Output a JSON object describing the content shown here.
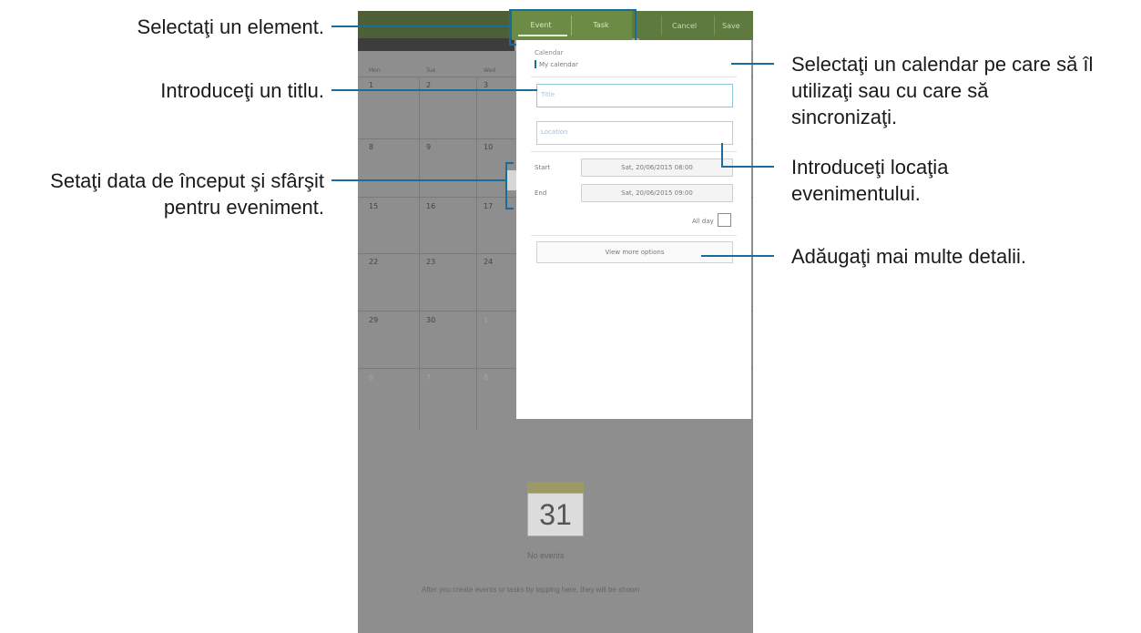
{
  "annotations": {
    "select_item": "Selectaţi un element.",
    "enter_title": "Introduceţi un titlu.",
    "set_dates_1": "Setaţi data de început şi sfârşit",
    "set_dates_2": "pentru eveniment.",
    "select_calendar_1": "Selectaţi un calendar pe care să îl",
    "select_calendar_2": "utilizaţi sau cu care să",
    "select_calendar_3": "sincronizaţi.",
    "enter_location_1": "Introduceţi locaţia",
    "enter_location_2": "evenimentului.",
    "add_details": "Adăugaţi mai multe detalii."
  },
  "tabs": {
    "event": "Event",
    "task": "Task"
  },
  "toolbar": {
    "cancel": "Cancel",
    "save": "Save"
  },
  "form": {
    "calendar_label": "Calendar",
    "calendar_value": "My calendar",
    "title_placeholder": "Title",
    "location_placeholder": "Location",
    "start_label": "Start",
    "start_value": "Sat, 20/06/2015 08:00",
    "end_label": "End",
    "end_value": "Sat, 20/06/2015 09:00",
    "allday_label": "All day",
    "more_options": "View more options"
  },
  "calendar": {
    "weekdays": [
      "Mon",
      "Tue",
      "Wed"
    ],
    "rows": [
      [
        "1",
        "2",
        "3"
      ],
      [
        "8",
        "9",
        "10"
      ],
      [
        "15",
        "16",
        "17"
      ],
      [
        "22",
        "23",
        "24"
      ],
      [
        "29",
        "30",
        "1"
      ],
      [
        "6",
        "7",
        "8"
      ]
    ]
  },
  "today": {
    "day": "31",
    "no_events": "No events",
    "hint": "After you create events or tasks by tapping here, they will be shown"
  }
}
